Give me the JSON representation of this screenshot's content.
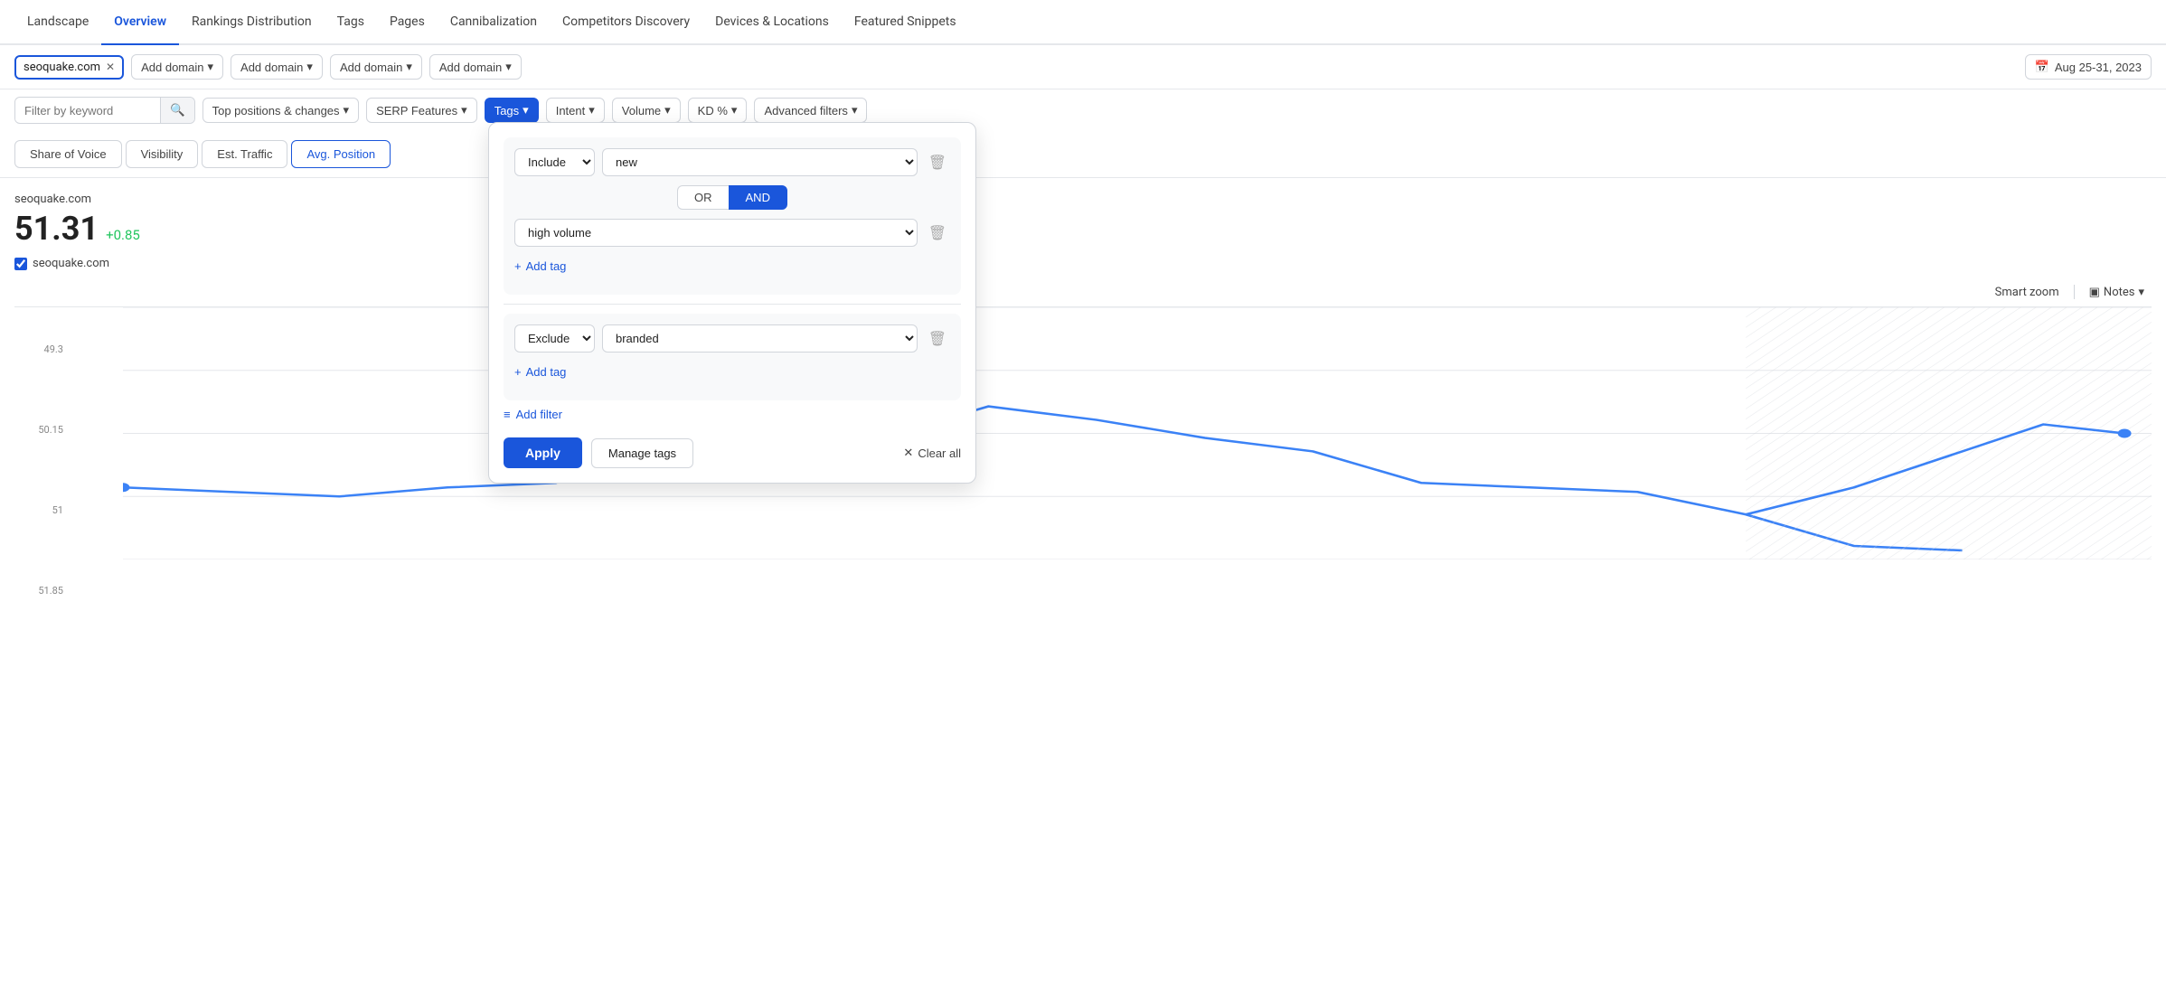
{
  "nav": {
    "items": [
      {
        "label": "Landscape",
        "active": false
      },
      {
        "label": "Overview",
        "active": true
      },
      {
        "label": "Rankings Distribution",
        "active": false
      },
      {
        "label": "Tags",
        "active": false
      },
      {
        "label": "Pages",
        "active": false
      },
      {
        "label": "Cannibalization",
        "active": false
      },
      {
        "label": "Competitors Discovery",
        "active": false
      },
      {
        "label": "Devices & Locations",
        "active": false
      },
      {
        "label": "Featured Snippets",
        "active": false
      }
    ]
  },
  "toolbar1": {
    "domain": "seoquake.com",
    "add_domain_label": "Add domain",
    "date_label": "Aug 25-31, 2023",
    "calendar_icon": "📅"
  },
  "toolbar2": {
    "search_placeholder": "Filter by keyword",
    "filters": [
      {
        "label": "Top positions & changes",
        "active": false
      },
      {
        "label": "SERP Features",
        "active": false
      },
      {
        "label": "Tags",
        "active": true
      },
      {
        "label": "Intent",
        "active": false
      },
      {
        "label": "Volume",
        "active": false
      },
      {
        "label": "KD %",
        "active": false
      },
      {
        "label": "Advanced filters",
        "active": false
      }
    ]
  },
  "metric_tabs": [
    {
      "label": "Share of Voice",
      "active": false
    },
    {
      "label": "Visibility",
      "active": false
    },
    {
      "label": "Est. Traffic",
      "active": false
    },
    {
      "label": "Avg. Position",
      "active": true
    }
  ],
  "chart": {
    "domain_label": "seoquake.com",
    "value": "51.31",
    "change": "+0.85",
    "checkbox_domain": "seoquake.com",
    "y_labels": [
      "49.3",
      "50.15",
      "51",
      "51.85"
    ],
    "smart_zoom_label": "Smart zoom",
    "notes_label": "Notes"
  },
  "tags_panel": {
    "include_label": "Include",
    "include_tag_value": "new",
    "or_label": "OR",
    "and_label": "AND",
    "high_volume_tag": "high volume",
    "add_tag_label": "Add tag",
    "exclude_label": "Exclude",
    "exclude_tag_value": "branded",
    "add_tag_label2": "Add tag",
    "add_filter_label": "Add filter",
    "apply_label": "Apply",
    "manage_tags_label": "Manage tags",
    "clear_all_label": "Clear all"
  }
}
